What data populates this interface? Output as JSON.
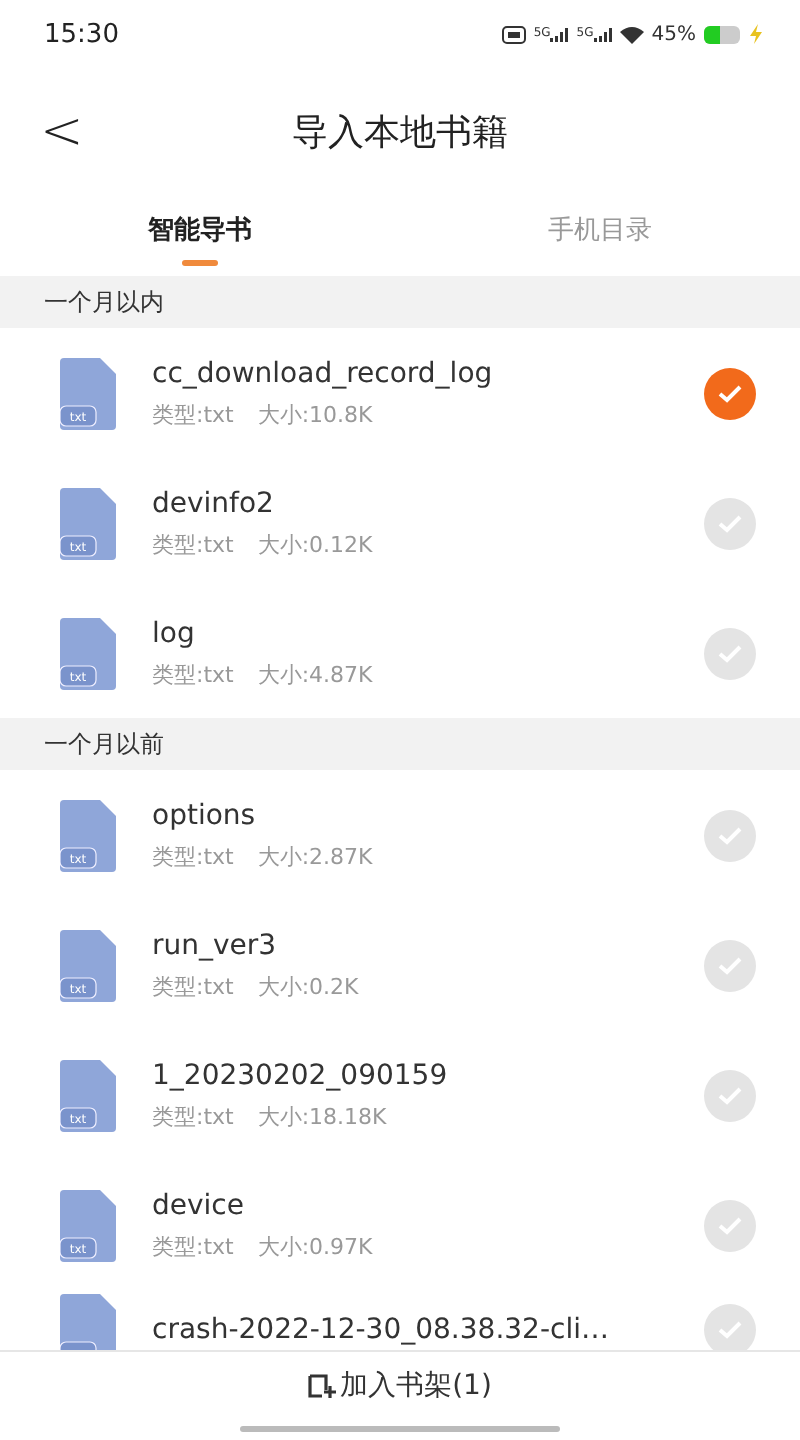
{
  "status_bar": {
    "time": "15:30",
    "network_labels": [
      "5G",
      "5G"
    ],
    "battery_percent": "45%"
  },
  "header": {
    "back": "<",
    "title": "导入本地书籍"
  },
  "tabs": [
    {
      "label": "智能导书",
      "selected": true
    },
    {
      "label": "手机目录",
      "selected": false
    }
  ],
  "sections": [
    {
      "title": "一个月以内",
      "files": [
        {
          "name": "cc_download_record_log",
          "badge": "txt",
          "type": "类型:txt",
          "size": "大小:10.8K",
          "selected": true
        },
        {
          "name": "devinfo2",
          "badge": "txt",
          "type": "类型:txt",
          "size": "大小:0.12K",
          "selected": false
        },
        {
          "name": "log",
          "badge": "txt",
          "type": "类型:txt",
          "size": "大小:4.87K",
          "selected": false
        }
      ]
    },
    {
      "title": "一个月以前",
      "files": [
        {
          "name": "options",
          "badge": "txt",
          "type": "类型:txt",
          "size": "大小:2.87K",
          "selected": false
        },
        {
          "name": "run_ver3",
          "badge": "txt",
          "type": "类型:txt",
          "size": "大小:0.2K",
          "selected": false
        },
        {
          "name": "1_20230202_090159",
          "badge": "txt",
          "type": "类型:txt",
          "size": "大小:18.18K",
          "selected": false
        },
        {
          "name": "device",
          "badge": "txt",
          "type": "类型:txt",
          "size": "大小:0.97K",
          "selected": false
        },
        {
          "name": "crash-2022-12-30_08.38.32-cli…",
          "selected": false
        }
      ]
    }
  ],
  "bottom_bar": {
    "button": "加入书架(1)"
  }
}
